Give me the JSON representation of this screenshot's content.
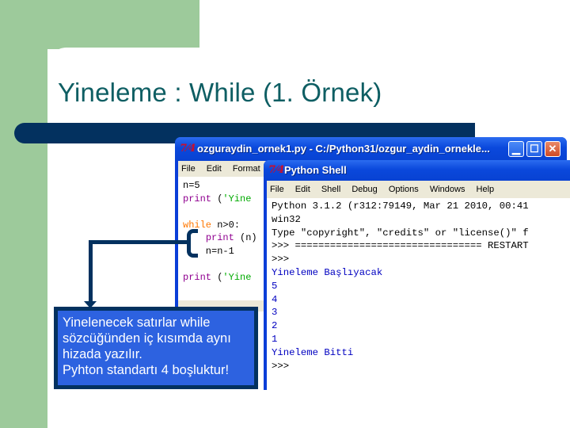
{
  "slide": {
    "title": "Yineleme : While (1. Örnek)",
    "colors": {
      "title": "#0e5e63",
      "accent_bar": "#03315f",
      "side_green": "#9dca9b",
      "note_bg": "#2d62e0"
    }
  },
  "editor_window": {
    "icon": "7⁄4",
    "title": "ozguraydin_ornek1.py - C:/Python31/ozgur_aydin_ornekle...",
    "controls": {
      "minimize": "▁",
      "maximize": "☐",
      "close": "✕"
    },
    "menu": [
      "File",
      "Edit",
      "Format"
    ],
    "code_lines": [
      {
        "parts": [
          {
            "t": "n=5",
            "c": "df"
          }
        ]
      },
      {
        "parts": [
          {
            "t": "print",
            "c": "bi"
          },
          {
            "t": " (",
            "c": "df"
          },
          {
            "t": "'Yine",
            "c": "st"
          }
        ]
      },
      {
        "parts": []
      },
      {
        "parts": [
          {
            "t": "while",
            "c": "kw"
          },
          {
            "t": " n>0:",
            "c": "df"
          }
        ]
      },
      {
        "parts": [
          {
            "t": "    ",
            "c": "df"
          },
          {
            "t": "print",
            "c": "bi"
          },
          {
            "t": " (n)",
            "c": "df"
          }
        ]
      },
      {
        "parts": [
          {
            "t": "    n=n-1",
            "c": "df"
          }
        ]
      },
      {
        "parts": []
      },
      {
        "parts": [
          {
            "t": "print",
            "c": "bi"
          },
          {
            "t": " (",
            "c": "df"
          },
          {
            "t": "'Yine",
            "c": "st"
          }
        ]
      }
    ]
  },
  "shell_window": {
    "icon": "7⁄4",
    "title": "Python Shell",
    "menu": [
      "File",
      "Edit",
      "Shell",
      "Debug",
      "Options",
      "Windows",
      "Help"
    ],
    "lines": [
      {
        "t": "Python 3.1.2 (r312:79149, Mar 21 2010, 00:41",
        "c": "df"
      },
      {
        "t": "win32",
        "c": "df"
      },
      {
        "t": "Type \"copyright\", \"credits\" or \"license()\" f",
        "c": "df"
      },
      {
        "t": ">>> ================================ RESTART",
        "c": "df"
      },
      {
        "t": ">>>",
        "c": "df"
      },
      {
        "t": "Yineleme Başlıyacak",
        "c": "out"
      },
      {
        "t": "5",
        "c": "out"
      },
      {
        "t": "4",
        "c": "out"
      },
      {
        "t": "3",
        "c": "out"
      },
      {
        "t": "2",
        "c": "out"
      },
      {
        "t": "1",
        "c": "out"
      },
      {
        "t": "Yineleme Bitti",
        "c": "out"
      },
      {
        "t": ">>>",
        "c": "df"
      }
    ]
  },
  "annotation": {
    "lines": [
      "Yinelenecek satırlar while",
      "sözcüğünden iç kısımda aynı",
      "hizada yazılır.",
      "Pyhton standartı 4 boşluktur!"
    ]
  }
}
